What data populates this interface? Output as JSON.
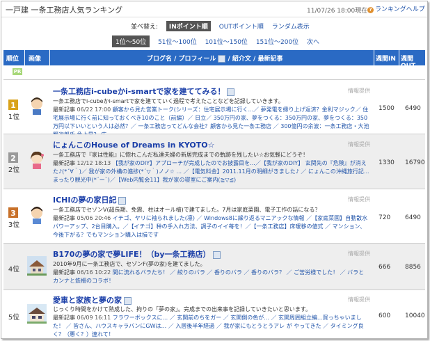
{
  "header": {
    "title_main": "一戸建 一条工務店人気ランキング",
    "date": "11/07/26 18:00現在",
    "help_label": "ランキングヘルプ"
  },
  "sort": {
    "label": "並べ替え:",
    "active": "INポイント順",
    "options": [
      "OUTポイント順",
      "ランダム表示"
    ]
  },
  "pages": {
    "active": "1位〜50位",
    "links": [
      "51位〜100位",
      "101位〜150位",
      "151位〜200位",
      "次へ"
    ]
  },
  "columns": {
    "rank": "順位",
    "image": "画像",
    "blog": "ブログ名 / プロフィール",
    "blog_suffix": " / 紹介文 / 最新記事",
    "in": "週間IN",
    "out": "週間OUT"
  },
  "pr_label": "PR",
  "info_label": "情報提供",
  "rows": [
    {
      "rank": "1位",
      "title": "一条工務店i-cubeかi-smartで家を建ててみる！",
      "desc": "一条工務店でi-cubeかi-smartで家を建てていく過程で考えたことなどを記録していきます。",
      "recent_label": "最新記事",
      "recent_date": "06/22 17:00",
      "recent": "顧客から見た営業トーク(シリーズ：住宅展示場に行く...／ 夢発電を縁り上げ返済？金利マジック／ 住宅展示場に行く前に知っておくべき10のこと（前編）／ 日立／ 350万円の家、夢をつくる：350万円の家、夢をつくる：350万円以下いいという人は必然？／ 一条工務店ってどんな会社？顧客から見た一条工務店 ／ 300億円の余波：一条工務店・大池賢次郎氏 急上昇？ 広...",
      "in": "1500",
      "out": "6490"
    },
    {
      "rank": "2位",
      "title": "にょんこのHouse of Dreams in KYOTO☆",
      "desc": "一条工務店で『家は性能』に惚れこんだ私達夫婦の新居完成までの軌跡を残したい☆お気軽にどうぞ！",
      "recent_label": "最新記事",
      "recent_date": "12/12 18:13",
      "recent": "【我が家のDIY】アプローチが完成したのでお披露目を...／【我が家のDIY】 玄関先の『危険』が消えた♪(*´∀｀)／ 我が家の外構の進捗(*´▽｀)ノノ☆ ... ／【電気料金】2011.11月の明細がきました♪ ／ にょんこの沖縄旅行記...まったり観光中(*´ー`)／【Web内覧会11】我が家の寝室にご案内(≧▽≦)",
      "in": "1330",
      "out": "16790"
    },
    {
      "rank": "3位",
      "title": "ICHIの夢の家日記",
      "desc": "一条工務店でセゾンV(超長期、免震、柱はオール檜)で建てました。7月は家庭菜園、電子工作の話になる？",
      "recent_label": "最新記事",
      "recent_date": "05/06 20:46",
      "recent": "イチゴ、ヤリに袖られました(凛) ／ Windows8に繰り返るマニアックな情報 ／【家庭菜園】自動散水パワーアップ、2台目購入。／【イチゴ】种の手入れ方法、調子のイイ苺を！／【一条工務店】床暖移の値式 ／ マンション、今後下がる？でもマンション購入は損です",
      "in": "720",
      "out": "6490"
    },
    {
      "rank": "4位",
      "title": "B170の夢の家で夢LIFE！（by一条工務店）",
      "desc": "2010年9月に一条工務店で、セゾンF(夢の家)を建てました。",
      "recent_label": "最新記事",
      "recent_date": "06/16 10:22",
      "recent": "間に流れるバラたち！ ／ 絞りのバラ ／ 香りのバラ ／ 香りのバラ？ ／ ご苦労様でした！ ／ バラとカンナと鉄柵のコラボ！",
      "in": "666",
      "out": "8856"
    },
    {
      "rank": "5位",
      "title": "愛車と家族と夢の家",
      "desc": "じっくり時間をかけて熟成した、拘りの「夢の家」。完成までの出来事を記録していきたいと思います。",
      "recent_label": "最新記事",
      "recent_date": "06/09 16:11",
      "recent": "フラワーボックスに... ／ 玄関前のちをガー ／ 玄関側の色が... ／ 玄関周囲組立編...買っちゃいました！ ／ 皆さん、ハウスキャラバンにGWは... ／ 入居後半年経過 ／ 我が家にもとうとうアレ が やってきた ／ タイミング良く？（悪く？）連れて！",
      "in": "600",
      "out": "10040"
    }
  ],
  "colors": {
    "header_blue": "#2a6ac4",
    "link_blue": "#1a3ea8",
    "alt_row": "#eeeeee"
  }
}
